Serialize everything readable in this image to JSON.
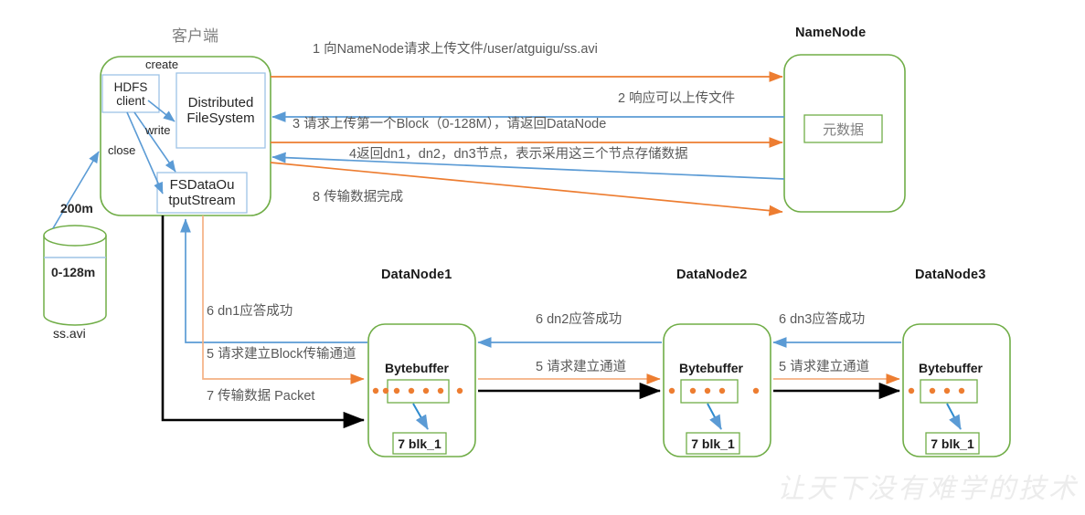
{
  "diagram": {
    "title": "HDFS write data flow",
    "watermark": "让天下没有难学的技术",
    "colors": {
      "orange": "#ED7D31",
      "blue": "#5B9BD5",
      "green": "#70AD47",
      "black": "#000000",
      "box_blue": "#9DC3E6",
      "text_gray": "#7f7f7f"
    }
  },
  "client": {
    "title": "客户端",
    "hdfs_client": "HDFS\nclient",
    "distributed_filesystem": "Distributed\nFileSystem",
    "fsdata_outputstream": "FSDataOu\ntputStream",
    "edge_create": "create",
    "edge_write": "write",
    "edge_close": "close"
  },
  "namenode": {
    "title": "NameNode",
    "metadata": "元数据"
  },
  "file": {
    "size_label": "200m",
    "block_label": "0-128m",
    "name": "ss.avi"
  },
  "datanodes": [
    {
      "title": "DataNode1",
      "buffer": "Bytebuffer",
      "block": "7 blk_1",
      "dots": 5
    },
    {
      "title": "DataNode2",
      "buffer": "Bytebuffer",
      "block": "7 blk_1",
      "dots": 3
    },
    {
      "title": "DataNode3",
      "buffer": "Bytebuffer",
      "block": "7 blk_1",
      "dots": 3
    }
  ],
  "flows": {
    "step1": "1 向NameNode请求上传文件/user/atguigu/ss.avi",
    "step2": "2 响应可以上传文件",
    "step3": "3 请求上传第一个Block（0-128M），请返回DataNode",
    "step4": "4返回dn1，dn2，dn3节点，表示采用这三个节点存储数据",
    "step8": "8 传输数据完成",
    "step6_dn1": "6 dn1应答成功",
    "step5_dn1": "5 请求建立Block传输通道",
    "step7_packet": "7 传输数据  Packet",
    "step6_dn2": "6 dn2应答成功",
    "step5_dn2": "5 请求建立通道",
    "step6_dn3": "6 dn3应答成功",
    "step5_dn3": "5 请求建立通道"
  }
}
